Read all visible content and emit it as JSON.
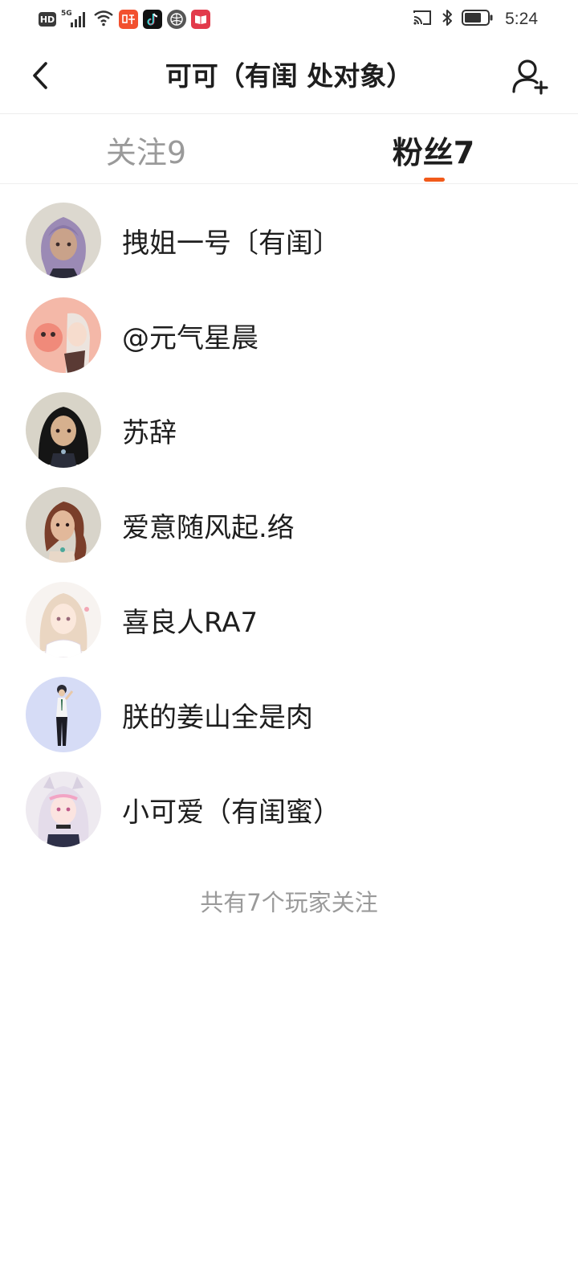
{
  "status_bar": {
    "hd_label": "HD",
    "network_label": "5G",
    "clock": "5:24",
    "icons": [
      "hd-icon",
      "signal-icon",
      "wifi-icon",
      "ting-app-icon",
      "tiktok-app-icon",
      "ball-app-icon",
      "book-app-icon",
      "cast-icon",
      "bluetooth-icon",
      "battery-icon"
    ]
  },
  "header": {
    "title": "可可（有闺 处对象）",
    "back_icon": "chevron-left-icon",
    "add_icon": "add-user-icon"
  },
  "tabs": [
    {
      "label": "关注9",
      "active": false
    },
    {
      "label": "粉丝7",
      "active": true
    }
  ],
  "accent_color": "#f25a1a",
  "fans": [
    {
      "name": "拽姐一号〔有闺〕"
    },
    {
      "name": "@元气星晨"
    },
    {
      "name": "苏辞"
    },
    {
      "name": "爱意随风起.络"
    },
    {
      "name": "喜良人RA7"
    },
    {
      "name": "朕的姜山全是肉"
    },
    {
      "name": "小可爱（有闺蜜）"
    }
  ],
  "footer_note": "共有7个玩家关注"
}
